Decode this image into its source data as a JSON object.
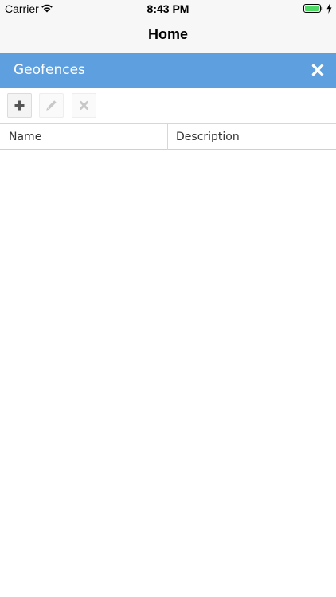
{
  "status_bar": {
    "carrier": "Carrier",
    "time": "8:43 PM",
    "battery_color": "#4cd964"
  },
  "nav": {
    "title": "Home"
  },
  "panel": {
    "title": "Geofences",
    "header_color": "#5d9fdf",
    "close_icon": "close-icon"
  },
  "toolbar": {
    "buttons": [
      {
        "icon": "plus-icon",
        "enabled": true
      },
      {
        "icon": "pencil-icon",
        "enabled": false
      },
      {
        "icon": "delete-icon",
        "enabled": false
      }
    ]
  },
  "table": {
    "columns": [
      "Name",
      "Description"
    ],
    "rows": []
  }
}
